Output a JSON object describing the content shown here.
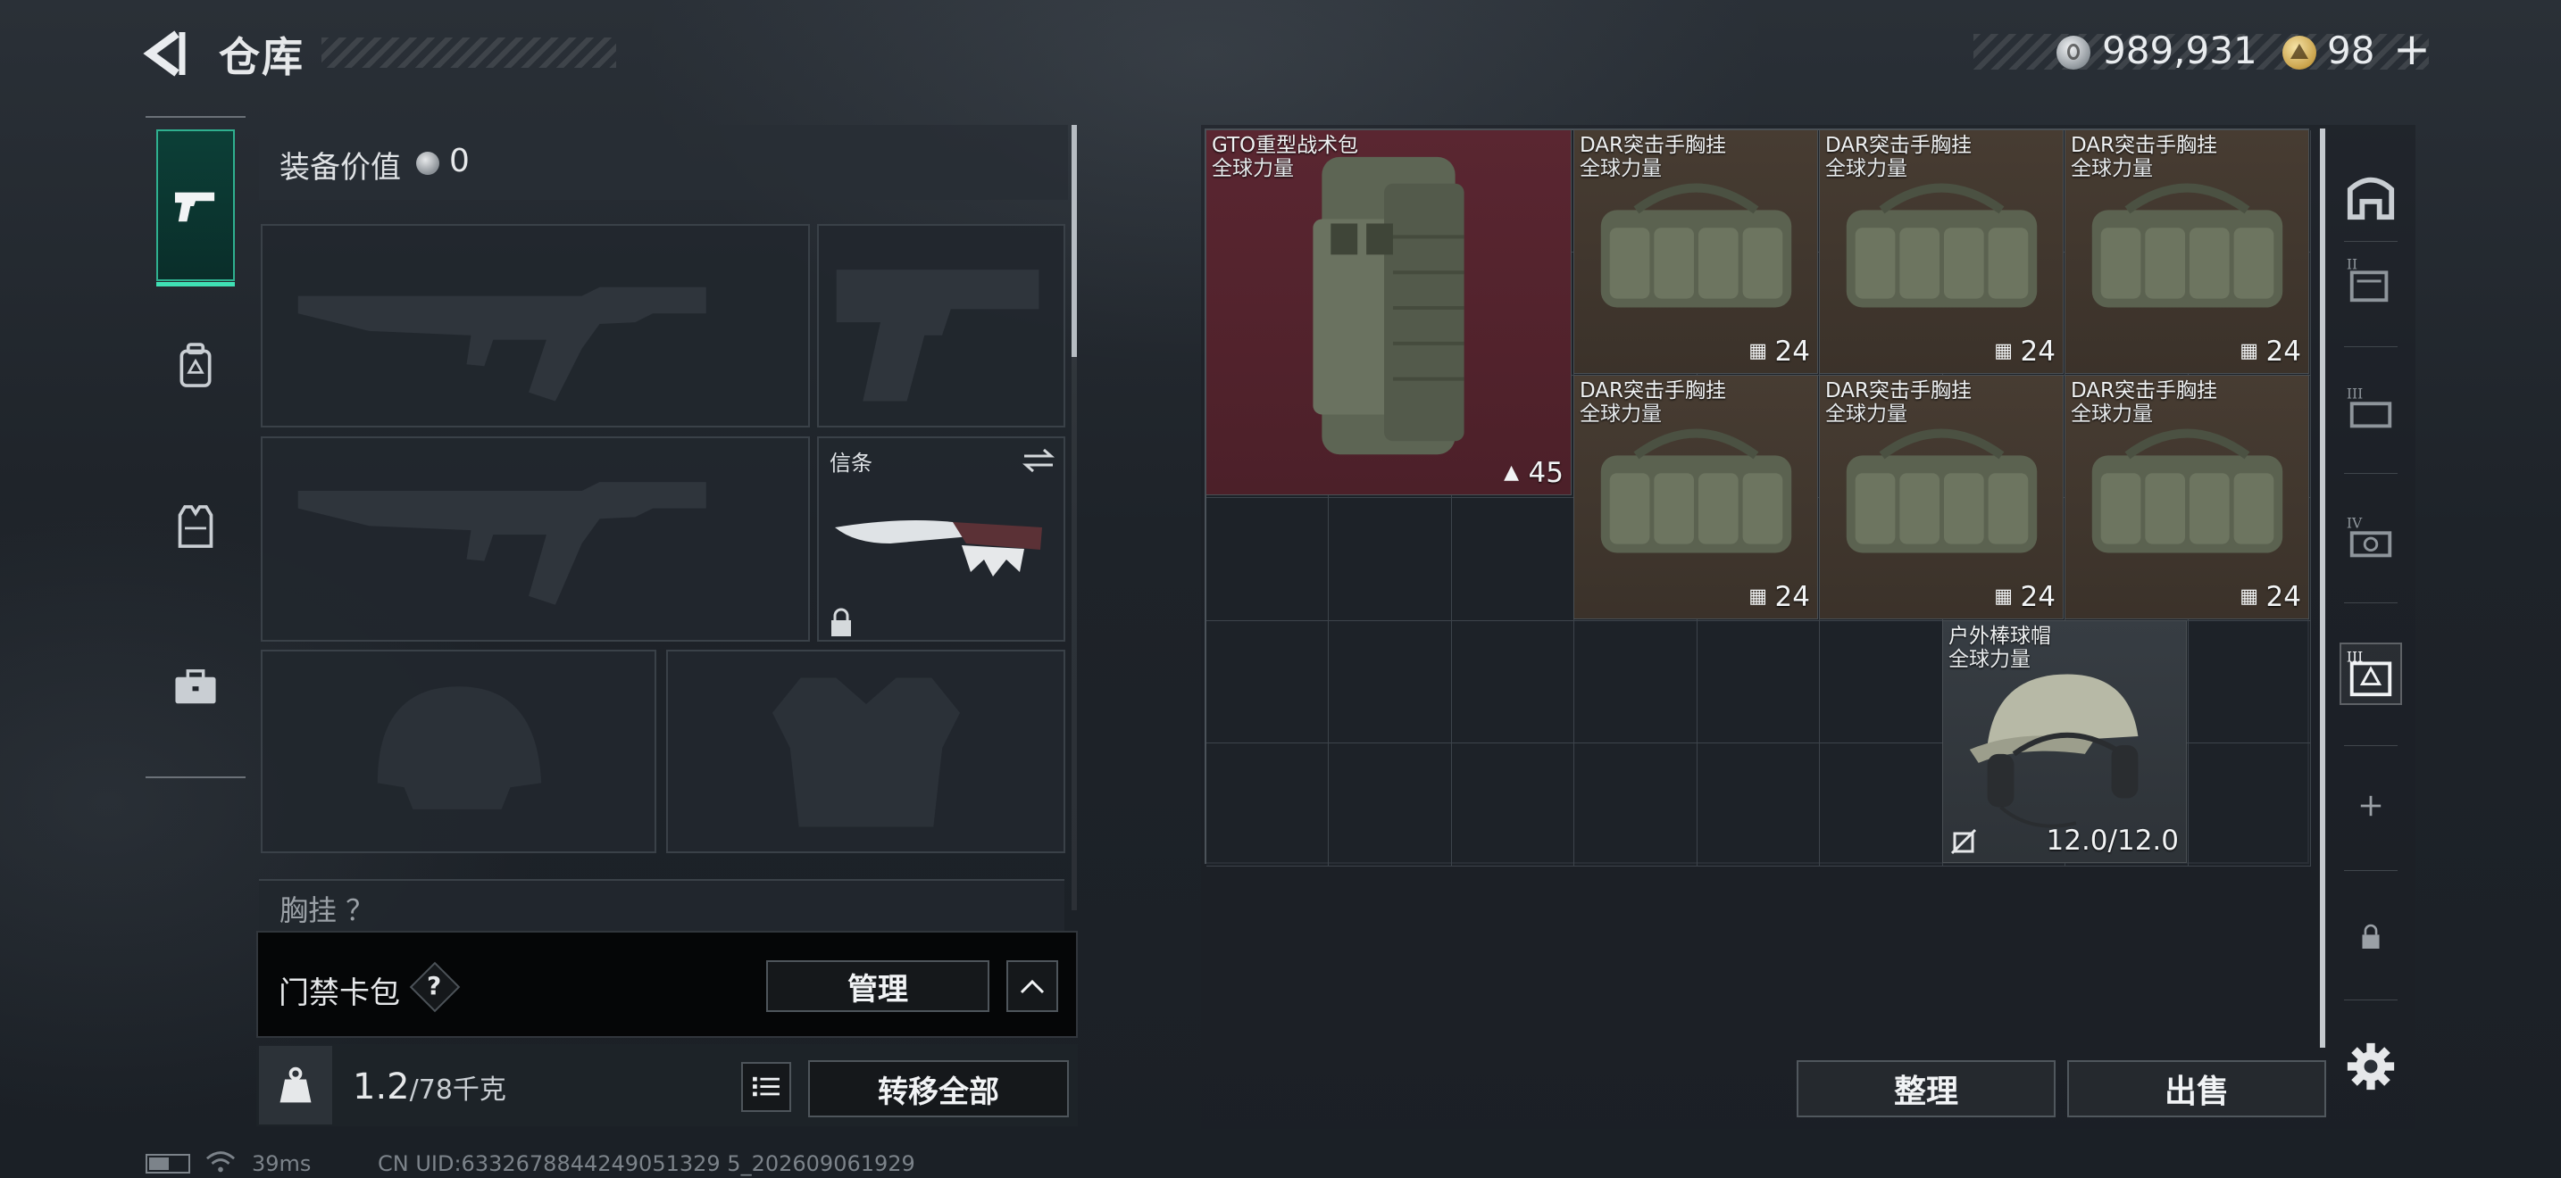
{
  "header": {
    "title": "仓库",
    "currency_silver": "989,931",
    "currency_gold": "98",
    "add_label": "+"
  },
  "left_rail": {
    "items": [
      {
        "name": "firearm",
        "icon": "pistol-icon",
        "active": true
      },
      {
        "name": "backpack",
        "icon": "backpack-icon",
        "active": false
      },
      {
        "name": "vest",
        "icon": "vest-icon",
        "active": false
      },
      {
        "name": "case",
        "icon": "briefcase-icon",
        "active": false
      }
    ]
  },
  "equipment": {
    "value_label": "装备价值",
    "value": "0",
    "slots": {
      "primary_1": {
        "label": "",
        "icon": "rifle-silhouette"
      },
      "pistol": {
        "label": "",
        "icon": "pistol-silhouette"
      },
      "primary_2": {
        "label": "",
        "icon": "rifle-silhouette"
      },
      "melee": {
        "label": "信条",
        "icon": "knife",
        "locked": true
      },
      "helmet": {
        "label": "",
        "icon": "helmet-silhouette"
      },
      "armor": {
        "label": "",
        "icon": "armor-silhouette"
      }
    },
    "chest_rig_label": "胸挂 ？"
  },
  "keycard": {
    "label": "门禁卡包",
    "help": "?",
    "manage_button": "管理"
  },
  "weight": {
    "icon_label": "KG",
    "current": "1.2",
    "capacity": "/78千克",
    "transfer_all_button": "转移全部"
  },
  "stash": {
    "items": [
      {
        "name": "GTO重型战术包",
        "sub": "全球力量",
        "count": "45",
        "count_icon": "capacity-icon",
        "rarity": "red"
      },
      {
        "name": "DAR突击手胸挂",
        "sub": "全球力量",
        "count": "24",
        "count_icon": "vest-capacity-icon",
        "rarity": "brown"
      },
      {
        "name": "DAR突击手胸挂",
        "sub": "全球力量",
        "count": "24",
        "count_icon": "vest-capacity-icon",
        "rarity": "brown"
      },
      {
        "name": "DAR突击手胸挂",
        "sub": "全球力量",
        "count": "24",
        "count_icon": "vest-capacity-icon",
        "rarity": "brown"
      },
      {
        "name": "DAR突击手胸挂",
        "sub": "全球力量",
        "count": "24",
        "count_icon": "vest-capacity-icon",
        "rarity": "brown"
      },
      {
        "name": "DAR突击手胸挂",
        "sub": "全球力量",
        "count": "24",
        "count_icon": "vest-capacity-icon",
        "rarity": "brown"
      },
      {
        "name": "DAR突击手胸挂",
        "sub": "全球力量",
        "count": "24",
        "count_icon": "vest-capacity-icon",
        "rarity": "brown"
      },
      {
        "name": "户外棒球帽",
        "sub": "全球力量",
        "count": "12.0/12.0",
        "count_icon": "no-armor-icon",
        "rarity": "grey"
      }
    ],
    "sort_button": "整理",
    "sell_button": "出售"
  },
  "right_rail": {
    "items": [
      {
        "icon": "stash-arch-icon"
      },
      {
        "icon": "stash-tier-2-icon",
        "tier": "II"
      },
      {
        "icon": "stash-tier-3-icon",
        "tier": "III"
      },
      {
        "icon": "stash-tier-4-icon",
        "tier": "IV"
      },
      {
        "icon": "stash-tier-3-bag-icon",
        "tier": "III",
        "active": true
      },
      {
        "icon": "add-icon"
      },
      {
        "icon": "lock-icon"
      },
      {
        "icon": "gear-icon"
      }
    ]
  },
  "footer": {
    "ping": "39ms",
    "uid": "CN UID:6332678844249051329 5_202609061929"
  }
}
